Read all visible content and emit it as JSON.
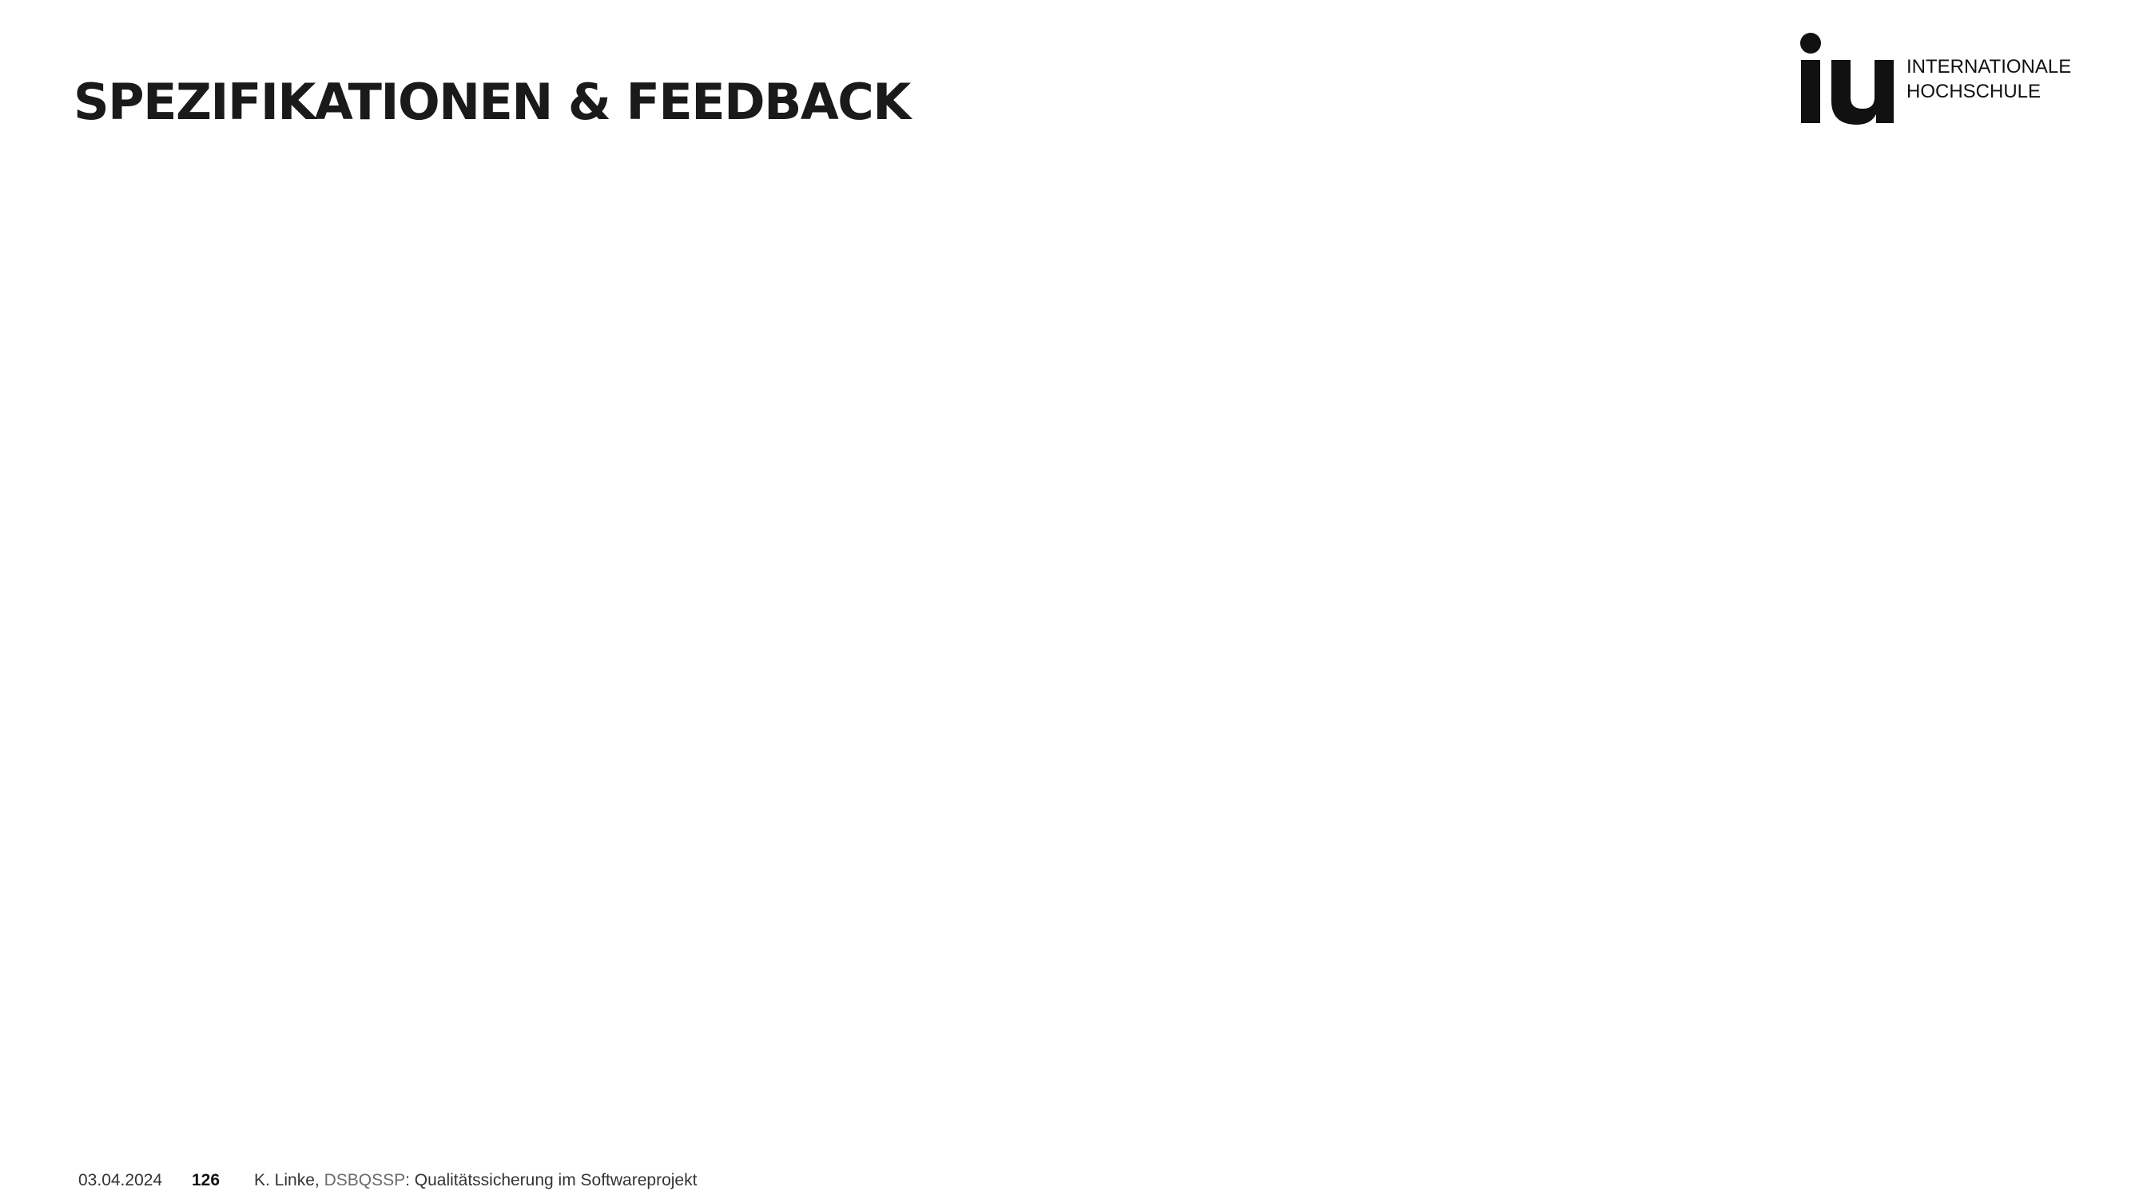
{
  "slide": {
    "title": "SPEZIFIKATIONEN & FEEDBACK"
  },
  "logo": {
    "icon": "iu-logo-icon",
    "mark_text": "iu",
    "line1": "INTERNATIONALE",
    "line2": "HOCHSCHULE",
    "color": "#111111"
  },
  "footer": {
    "date": "03.04.2024",
    "page_number": "126",
    "author": "K. Linke, ",
    "course_code": "DSBQSSP",
    "course_title": ": Qualitätssicherung im Softwareprojekt",
    "code_color": "#6b6b6b"
  }
}
